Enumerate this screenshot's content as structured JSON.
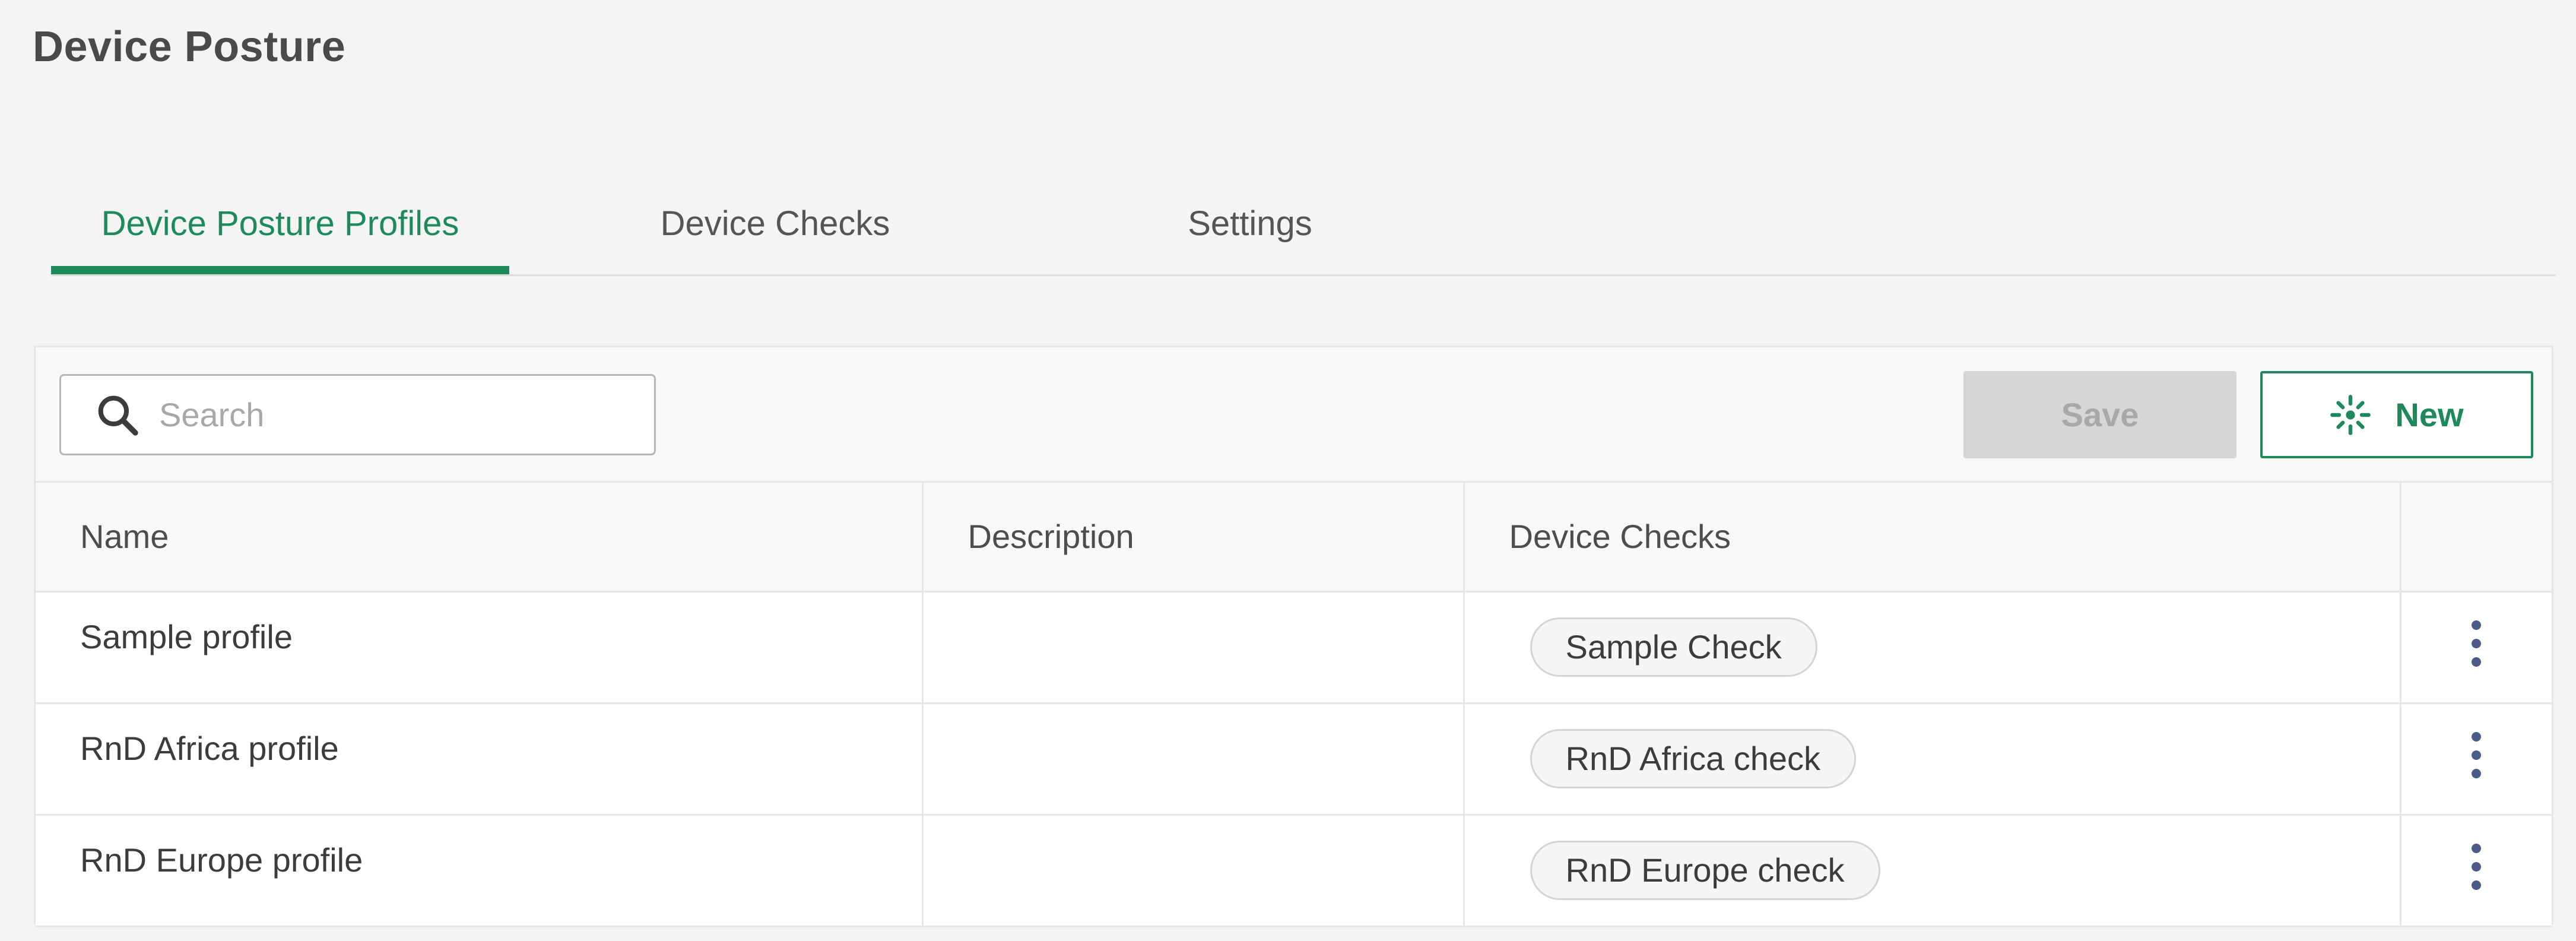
{
  "page": {
    "title": "Device Posture"
  },
  "tabs": [
    {
      "label": "Device Posture Profiles",
      "active": true
    },
    {
      "label": "Device Checks",
      "active": false
    },
    {
      "label": "Settings",
      "active": false
    }
  ],
  "toolbar": {
    "search_placeholder": "Search",
    "search_value": "",
    "save_label": "Save",
    "save_disabled": true,
    "new_label": "New"
  },
  "table": {
    "columns": [
      "Name",
      "Description",
      "Device Checks",
      ""
    ],
    "rows": [
      {
        "name": "Sample profile",
        "description": "",
        "checks": [
          "Sample Check"
        ]
      },
      {
        "name": "RnD Africa profile",
        "description": "",
        "checks": [
          "RnD Africa check"
        ]
      },
      {
        "name": "RnD Europe profile",
        "description": "",
        "checks": [
          "RnD Europe check"
        ]
      }
    ]
  },
  "icons": {
    "search": "search-icon",
    "new": "sparkle-icon",
    "row_menu": "more-vertical-icon"
  },
  "colors": {
    "accent": "#1d8a5c",
    "background": "#f4f4f4",
    "disabled_button": "#d6d6d6",
    "kebab": "#4b5c8a"
  }
}
